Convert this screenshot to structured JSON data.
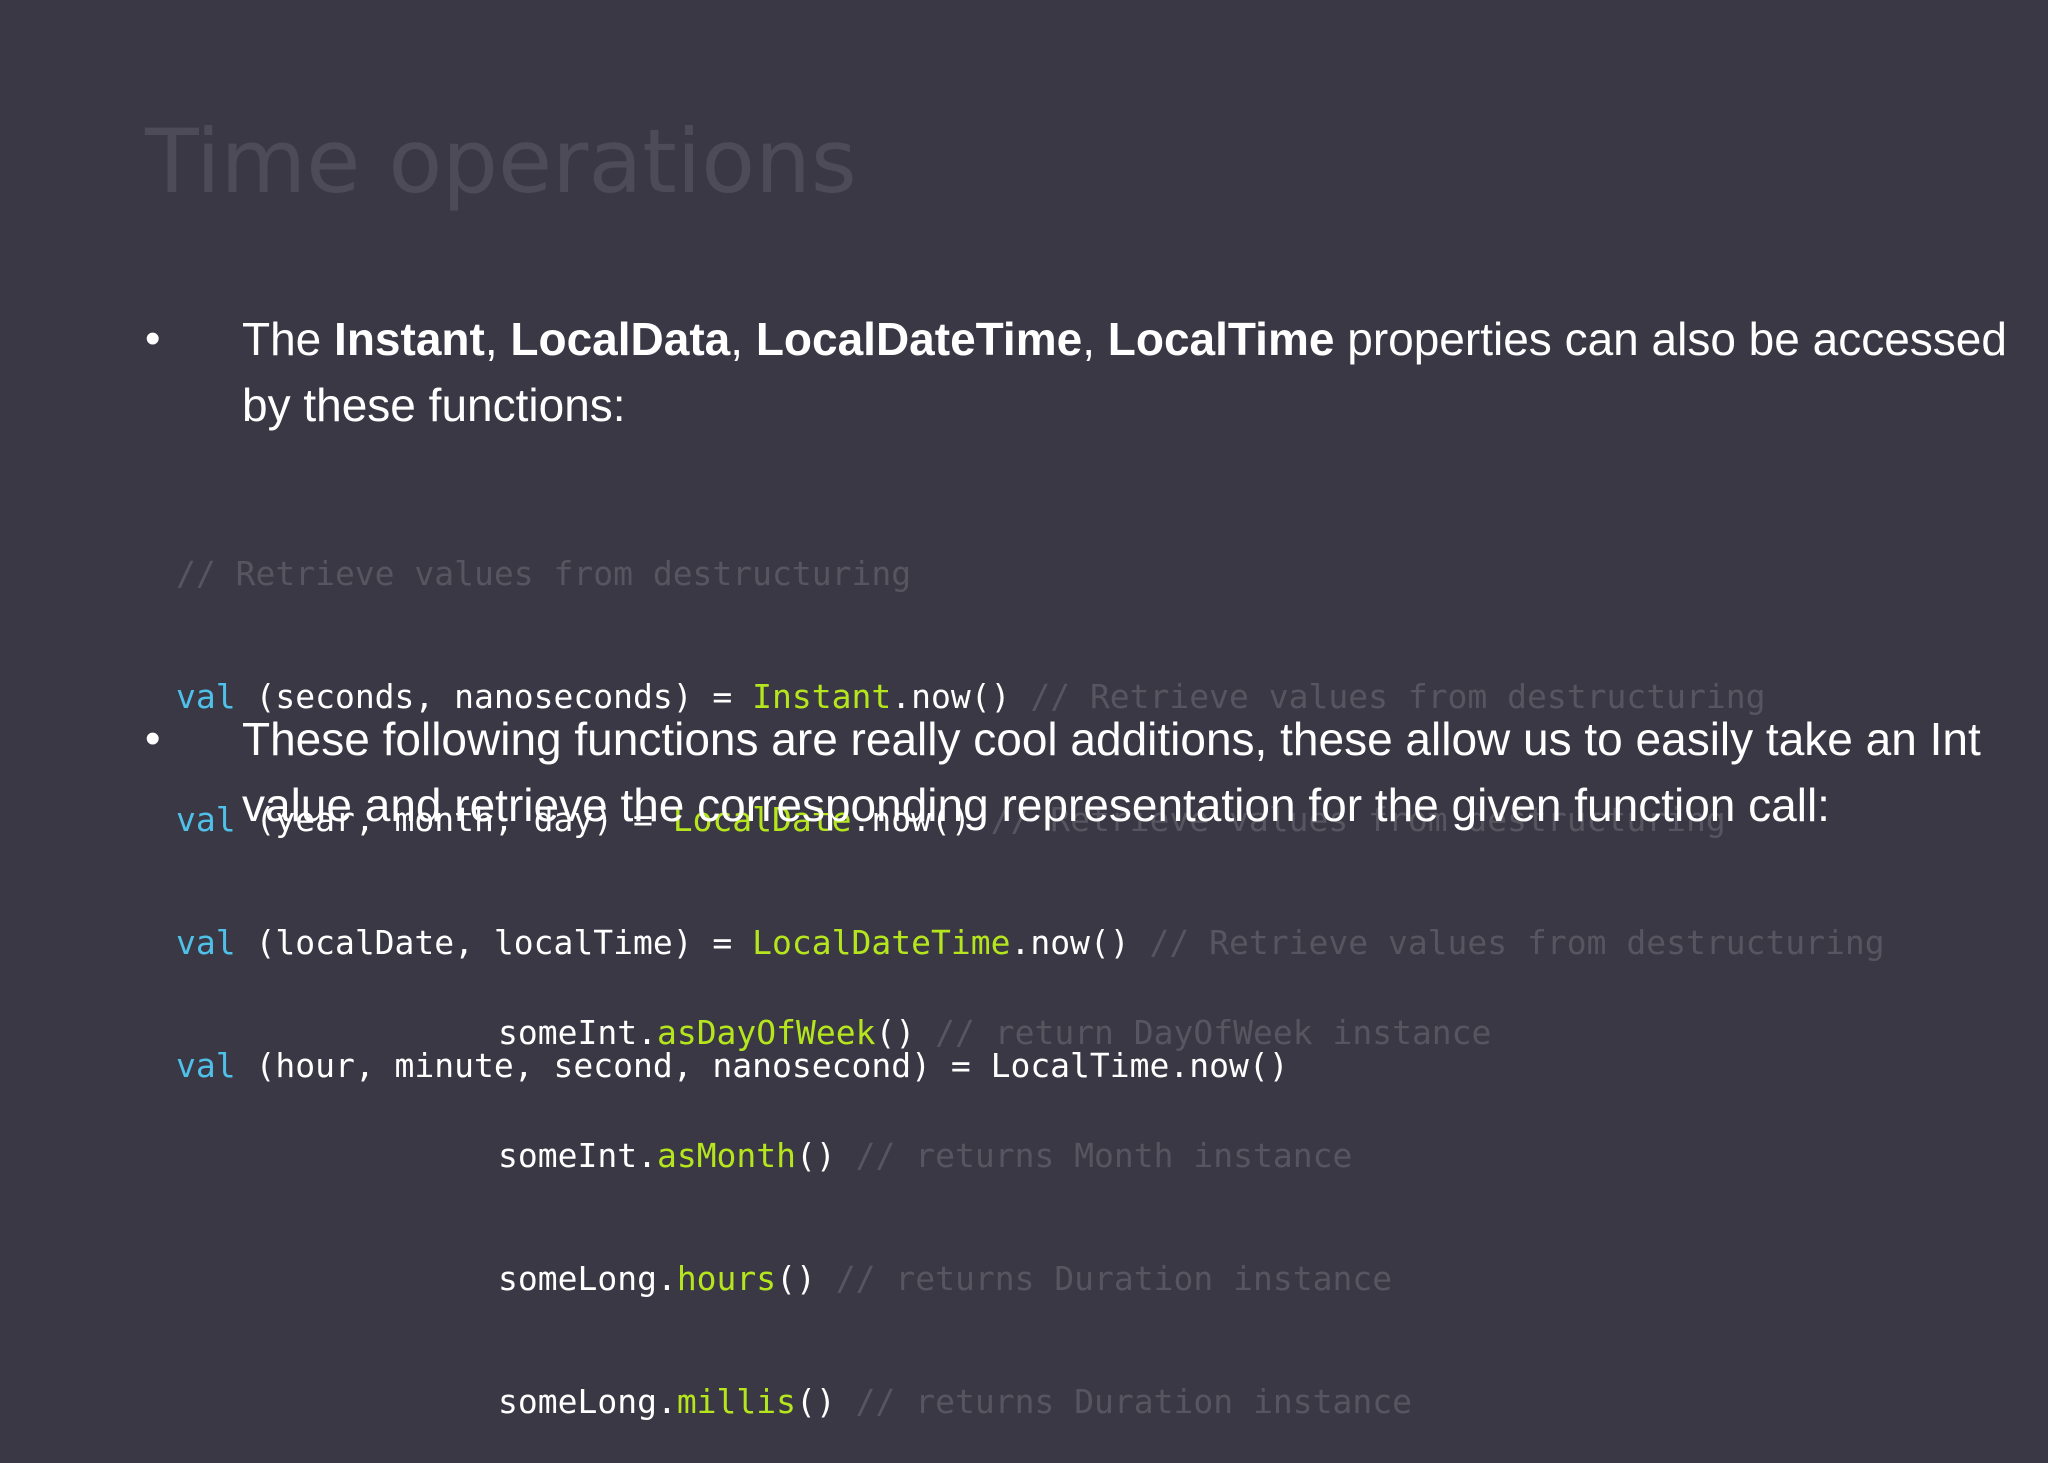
{
  "slide": {
    "title": "Time operations",
    "bullet1": {
      "prefix": "The ",
      "b1": "Instant",
      "sep1": ", ",
      "b2": "LocalData",
      "sep2": ", ",
      "b3": "LocalDateTime",
      "sep3": ", ",
      "b4": "LocalTime",
      "suffix": " properties can also be accessed by these functions:"
    },
    "code1": {
      "comment_line": "// Retrieve values from destructuring",
      "lines": [
        {
          "kw": "val",
          "lhs": " (seconds, nanoseconds) = ",
          "type": "Instant",
          "call": ".now()",
          "comment": " // Retrieve values from destructuring"
        },
        {
          "kw": "val",
          "lhs": " (year, month, day) = ",
          "type": "LocalDate",
          "call": ".now()",
          "comment": " // Retrieve values from destructuring"
        },
        {
          "kw": "val",
          "lhs": " (localDate, localTime) = ",
          "type": "LocalDateTime",
          "call": ".now()",
          "comment": " // Retrieve values from destructuring"
        },
        {
          "kw": "val",
          "lhs": " (hour, minute, second, nanosecond) = LocalTime.now()"
        }
      ]
    },
    "bullet2": {
      "text": "These following functions are really cool additions, these allow us to easily take an Int value and retrieve the corresponding representation for the given function call:"
    },
    "code2": {
      "lines": [
        {
          "recv": "someInt.",
          "fn": "asDayOfWeek",
          "paren": "()",
          "comment": " // return DayOfWeek instance"
        },
        {
          "recv": "someInt.",
          "fn": "asMonth",
          "paren": "()",
          "comment": " // returns Month instance"
        },
        {
          "recv": "someLong.",
          "fn": "hours",
          "paren": "()",
          "comment": " // returns Duration instance"
        },
        {
          "recv": "someLong.",
          "fn": "millis",
          "paren": "()",
          "comment": " // returns Duration instance"
        }
      ]
    }
  }
}
